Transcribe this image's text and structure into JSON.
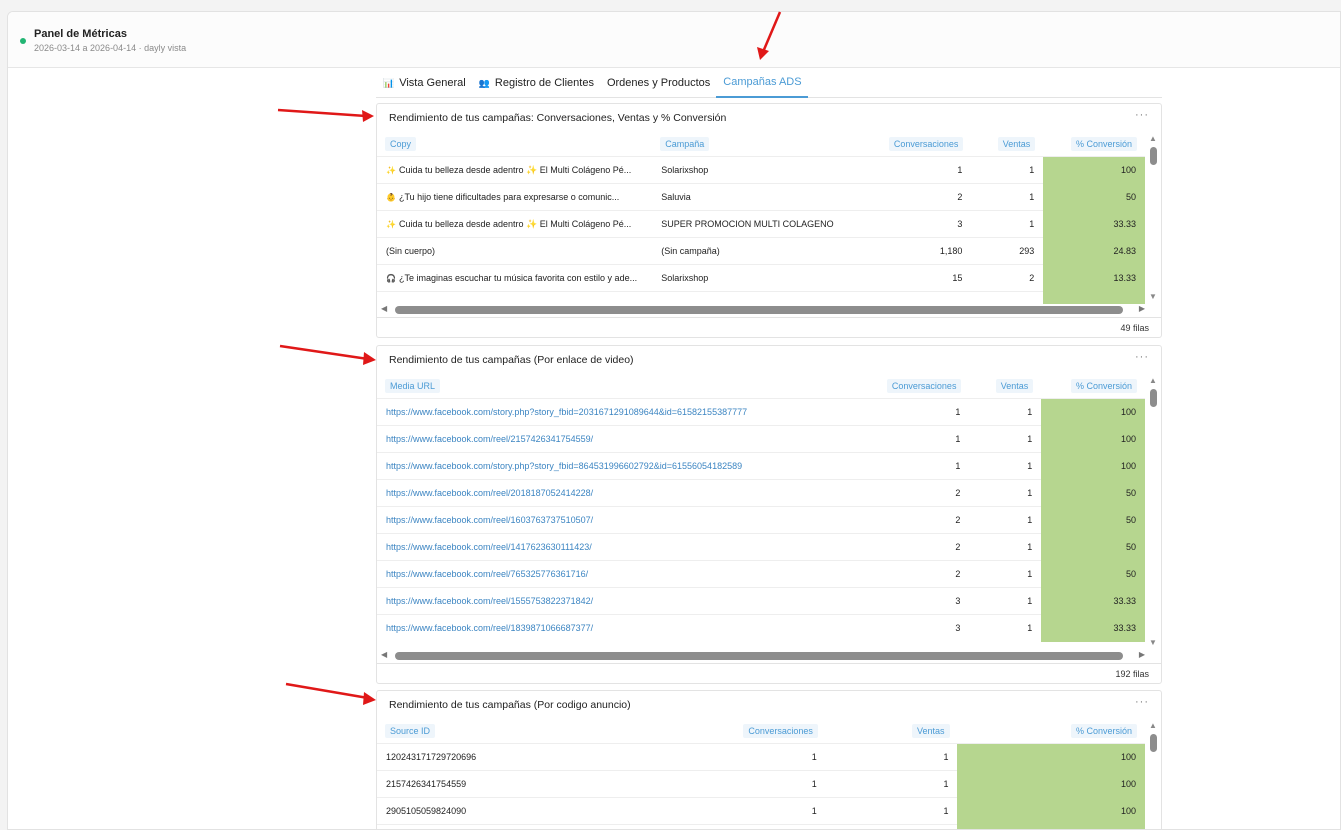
{
  "header": {
    "title": "Panel de Métricas",
    "subtitle": "2026-03-14 a 2026-04-14 · dayly vista"
  },
  "tabs": [
    {
      "label": "Vista General",
      "icon": "chart-icon"
    },
    {
      "label": "Registro de Clientes",
      "icon": "users-icon"
    },
    {
      "label": "Ordenes y Productos",
      "icon": ""
    },
    {
      "label": "Campañas ADS",
      "icon": "",
      "active": true
    }
  ],
  "card1": {
    "title": "Rendimiento de tus campañas: Conversaciones, Ventas y % Conversión",
    "columns": [
      "Copy",
      "Campaña",
      "Conversaciones",
      "Ventas",
      "% Conversión"
    ],
    "rows": [
      {
        "copy": "Cuida tu belleza desde adentro ✨ El Multi Colágeno Pé...",
        "emoji": "✨",
        "campaign": "Solarixshop",
        "conv": "1",
        "sales": "1",
        "pct": "100"
      },
      {
        "copy": "¿Tu hijo tiene dificultades para expresarse o comunic...",
        "emoji": "👶",
        "campaign": "Saluvia",
        "conv": "2",
        "sales": "1",
        "pct": "50"
      },
      {
        "copy": "Cuida tu belleza desde adentro ✨ El Multi Colágeno Pé...",
        "emoji": "✨",
        "campaign": "SUPER PROMOCION MULTI COLAGENO",
        "conv": "3",
        "sales": "1",
        "pct": "33.33"
      },
      {
        "copy": "(Sin cuerpo)",
        "emoji": "",
        "campaign": "(Sin campaña)",
        "conv": "1,180",
        "sales": "293",
        "pct": "24.83"
      },
      {
        "copy": "¿Te imaginas escuchar tu música favorita con estilo y ade...",
        "emoji": "🎧",
        "campaign": "Solarixshop",
        "conv": "15",
        "sales": "2",
        "pct": "13.33"
      }
    ],
    "footer": "49 filas"
  },
  "card2": {
    "title": "Rendimiento de tus campañas (Por enlace de video)",
    "columns": [
      "Media URL",
      "Conversaciones",
      "Ventas",
      "% Conversión"
    ],
    "rows": [
      {
        "url": "https://www.facebook.com/story.php?story_fbid=2031671291089644&id=61582155387777",
        "conv": "1",
        "sales": "1",
        "pct": "100"
      },
      {
        "url": "https://www.facebook.com/reel/2157426341754559/",
        "conv": "1",
        "sales": "1",
        "pct": "100"
      },
      {
        "url": "https://www.facebook.com/story.php?story_fbid=864531996602792&id=61556054182589",
        "conv": "1",
        "sales": "1",
        "pct": "100"
      },
      {
        "url": "https://www.facebook.com/reel/2018187052414228/",
        "conv": "2",
        "sales": "1",
        "pct": "50"
      },
      {
        "url": "https://www.facebook.com/reel/1603763737510507/",
        "conv": "2",
        "sales": "1",
        "pct": "50"
      },
      {
        "url": "https://www.facebook.com/reel/1417623630111423/",
        "conv": "2",
        "sales": "1",
        "pct": "50"
      },
      {
        "url": "https://www.facebook.com/reel/765325776361716/",
        "conv": "2",
        "sales": "1",
        "pct": "50"
      },
      {
        "url": "https://www.facebook.com/reel/1555753822371842/",
        "conv": "3",
        "sales": "1",
        "pct": "33.33"
      },
      {
        "url": "https://www.facebook.com/reel/1839871066687377/",
        "conv": "3",
        "sales": "1",
        "pct": "33.33"
      }
    ],
    "footer": "192 filas"
  },
  "card3": {
    "title": "Rendimiento de tus campañas (Por codigo anuncio)",
    "columns": [
      "Source ID",
      "Conversaciones",
      "Ventas",
      "% Conversión"
    ],
    "rows": [
      {
        "id": "120243171729720696",
        "conv": "1",
        "sales": "1",
        "pct": "100"
      },
      {
        "id": "2157426341754559",
        "conv": "1",
        "sales": "1",
        "pct": "100"
      },
      {
        "id": "2905105059824090",
        "conv": "1",
        "sales": "1",
        "pct": "100"
      }
    ]
  },
  "colors": {
    "accent": "#4b9bd5",
    "highlight": "#b6d68f",
    "arrow": "#e01818",
    "status": "#22b573"
  }
}
